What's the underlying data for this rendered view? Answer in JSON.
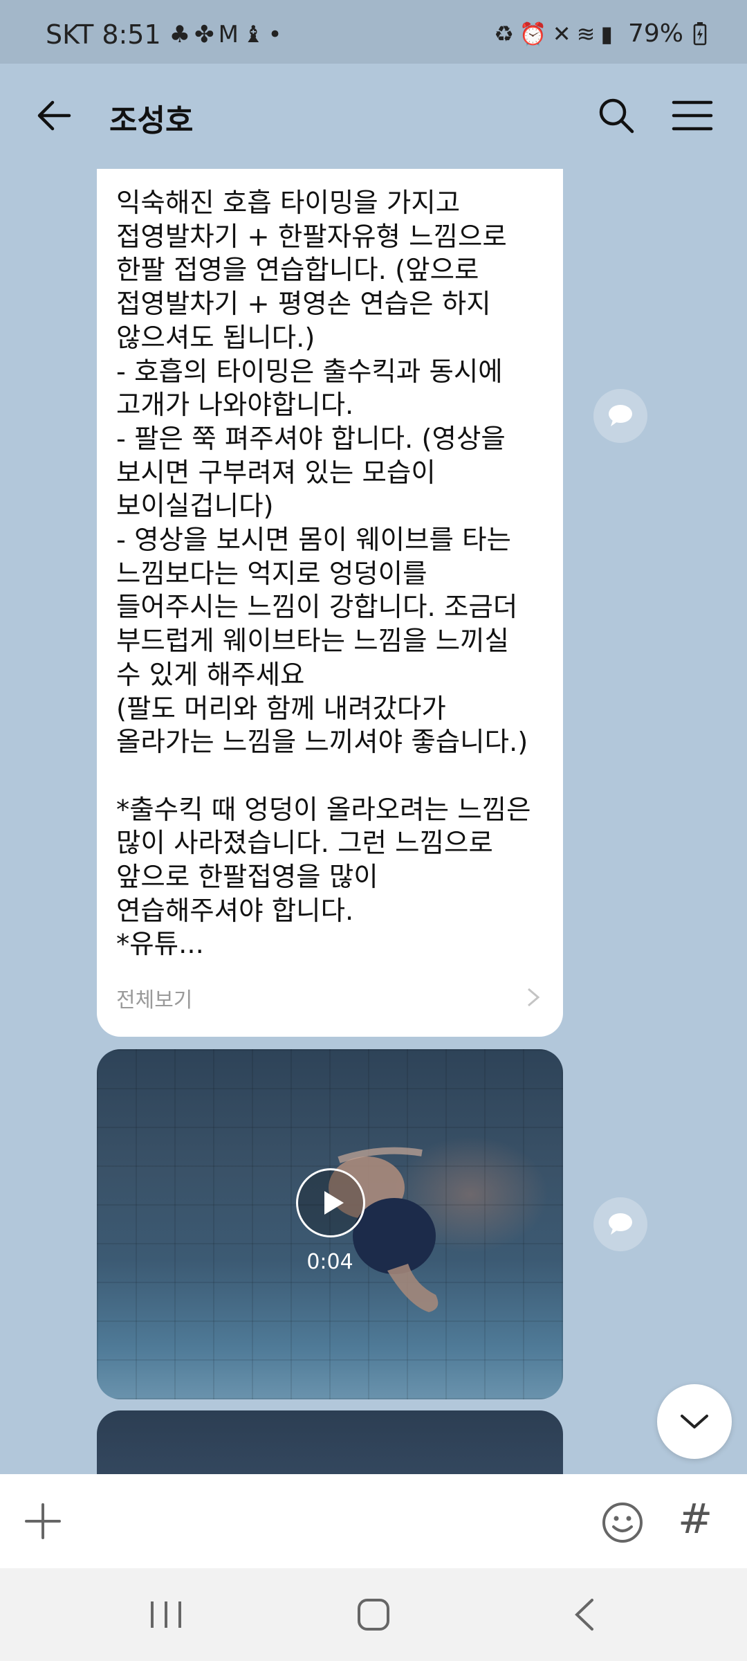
{
  "status_bar": {
    "carrier": "SKT",
    "time": "8:51",
    "left_icons": [
      "clover-icon",
      "fan-icon",
      "gmail-icon",
      "app-icon",
      "dot-icon"
    ],
    "right_icons": [
      "recycle-icon",
      "alarm-icon",
      "mute-icon",
      "wifi-icon",
      "signal-icon"
    ],
    "battery": "79%"
  },
  "header": {
    "title": "조성호"
  },
  "message": {
    "text": "익숙해진 호흡 타이밍을 가지고\n접영발차기 + 한팔자유형 느낌으로\n한팔 접영을 연습합니다. (앞으로\n접영발차기 + 평영손 연습은 하지\n않으셔도 됩니다.)\n- 호흡의 타이밍은 출수킥과 동시에\n고개가 나와야합니다.\n- 팔은 쭉 펴주셔야 합니다. (영상을\n보시면 구부려져 있는 모습이\n보이실겁니다)\n- 영상을 보시면 몸이 웨이브를 타는\n느낌보다는 억지로 엉덩이를\n들어주시는 느낌이 강합니다. 조금더\n부드럽게 웨이브타는 느낌을 느끼실\n수 있게 해주세요\n(팔도 머리와 함께 내려갔다가\n올라가는 느낌을 느끼셔야 좋습니다.)\n\n*출수킥 때 엉덩이 올라오려는 느낌은\n많이 사라졌습니다. 그런 느낌으로\n앞으로 한팔접영을 많이\n연습해주셔야 합니다.\n*유튜...",
    "see_all": "전체보기"
  },
  "video": {
    "duration": "0:04"
  },
  "input_bar": {
    "hash": "#"
  }
}
